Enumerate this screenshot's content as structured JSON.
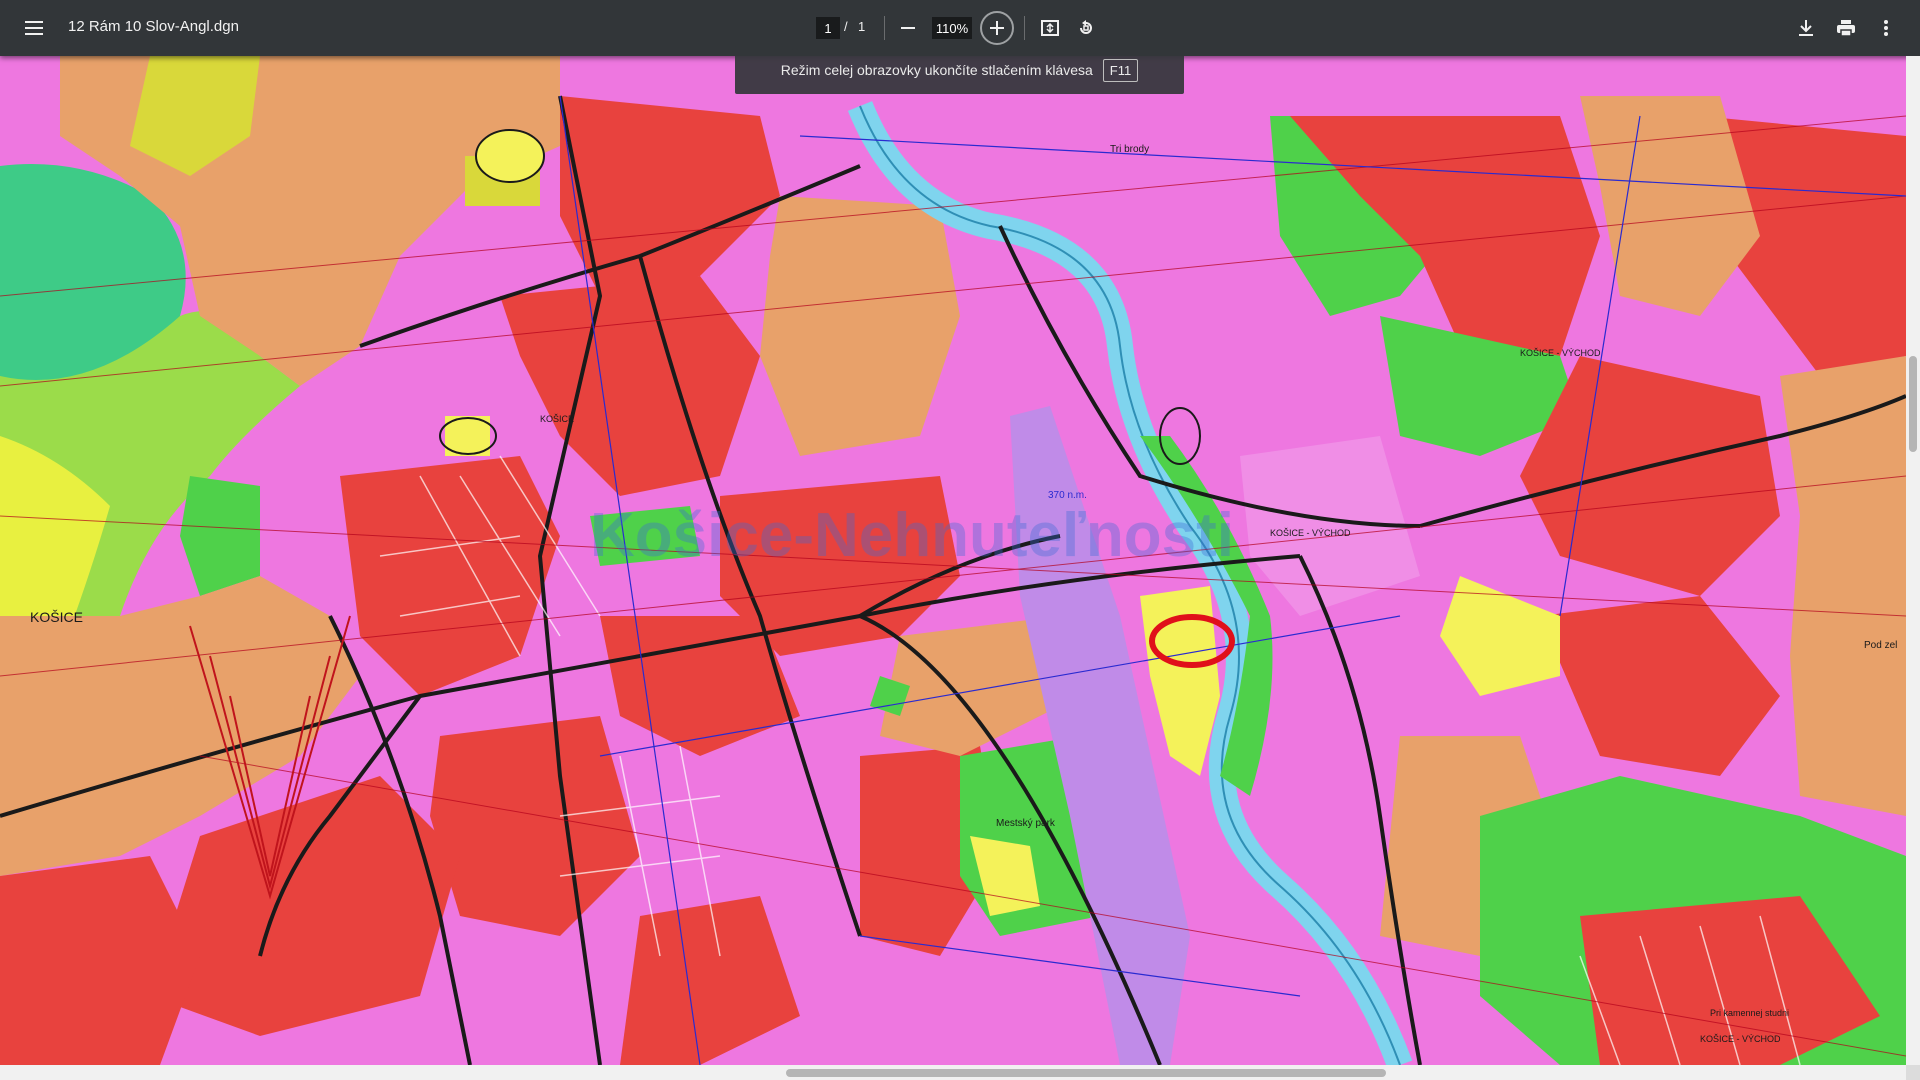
{
  "toolbar": {
    "title": "12 Rám 10 Slov-Angl.dgn",
    "page_current": "1",
    "page_separator": "/",
    "page_total": "1",
    "zoom": "110%",
    "icons": [
      "menu-icon",
      "zoom-out-icon",
      "zoom-in-icon",
      "fit-page-icon",
      "rotate-icon",
      "download-icon",
      "print-icon",
      "more-icon"
    ]
  },
  "toast": {
    "message": "Režim celej obrazovky ukončíte stlačením klávesa",
    "key": "F11"
  },
  "map": {
    "watermark": "Košice-Nehnuteľnosti",
    "labels": {
      "tri_brody": "Tri brody",
      "kosice_vychod_1": "KOŠICE - VÝCHOD",
      "kosice_vychod_2": "KOŠICE - VÝCHOD",
      "kosice_vychod_3": "KOŠICE - VÝCHOD",
      "kosice_west": "KOŠICE",
      "kosice_center": "KOŠICE",
      "mestsky_park": "Mestský park",
      "contour_370": "370 n.m.",
      "pod_zel": "Pod zel",
      "kamenny_studnicky": "Pri kamennej studni"
    },
    "colors": {
      "residential": "#e8a16a",
      "commercial": "#e8423e",
      "mixed": "#ee77e0",
      "green": "#4fd14a",
      "forest": "#3ecb87",
      "yellow": "#f4f25a",
      "rail": "#c08be8",
      "river": "#7fd4ee",
      "highlight": "#e0101a"
    }
  }
}
